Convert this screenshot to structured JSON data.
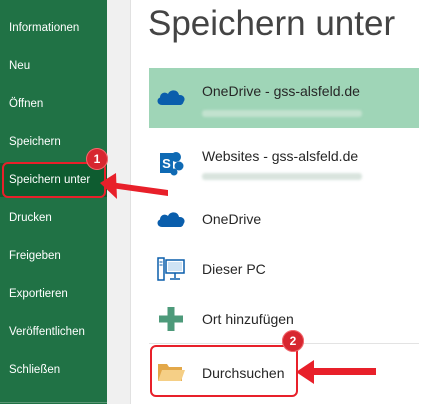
{
  "sidebar": {
    "items": [
      {
        "label": "Informationen"
      },
      {
        "label": "Neu"
      },
      {
        "label": "Öffnen"
      },
      {
        "label": "Speichern"
      },
      {
        "label": "Speichern unter",
        "selected": true
      },
      {
        "label": "Drucken"
      },
      {
        "label": "Freigeben"
      },
      {
        "label": "Exportieren"
      },
      {
        "label": "Veröffentlichen"
      },
      {
        "label": "Schließen"
      }
    ]
  },
  "main": {
    "title": "Speichern unter",
    "locations": [
      {
        "label": "OneDrive - gss-alsfeld.de",
        "icon": "onedrive-cloud-icon",
        "selected": true
      },
      {
        "label": "Websites - gss-alsfeld.de",
        "icon": "sharepoint-icon"
      },
      {
        "label": "OneDrive",
        "icon": "onedrive-cloud-icon"
      },
      {
        "label": "Dieser PC",
        "icon": "computer-icon"
      },
      {
        "label": "Ort hinzufügen",
        "icon": "plus-icon"
      },
      {
        "label": "Durchsuchen",
        "icon": "folder-icon"
      }
    ]
  },
  "annotations": {
    "badge_1": "1",
    "badge_2": "2"
  },
  "colors": {
    "sidebar_bg": "#207245",
    "sidebar_selected": "#0e5c30",
    "row_selected": "#9fd5b7",
    "annotation_red": "#e8202a",
    "onedrive_blue": "#0a5eac",
    "sharepoint_blue": "#0f6ab4",
    "plus_green": "#4d9a7a",
    "folder_orange": "#f0c27b"
  }
}
